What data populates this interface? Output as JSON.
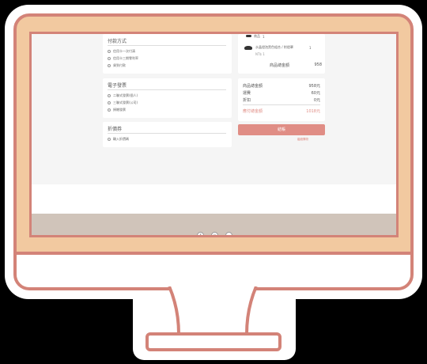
{
  "payment": {
    "title": "付款方式",
    "options": [
      "信用卡一次付清",
      "信用卡三期零利率",
      "貨到付款"
    ]
  },
  "invoice": {
    "title": "電子發票",
    "options": [
      "二聯式發票(個人)",
      "三聯式發票(公司)",
      "捐贈發票"
    ]
  },
  "notes": {
    "title": "折價券",
    "options": [
      "輸入折價碼"
    ]
  },
  "cart": {
    "items": [
      {
        "name": "商品",
        "qty": "1"
      },
      {
        "name": "水晶燈泡黑色組合 / 附燈罩",
        "qty": "1"
      }
    ],
    "subtotal_label": "商品總金額",
    "subtotal_value": "958"
  },
  "summary": {
    "rows": [
      {
        "label": "商品總金額",
        "value": "958元"
      },
      {
        "label": "運費",
        "value": "60元"
      },
      {
        "label": "折扣",
        "value": "0元"
      }
    ],
    "total_label": "應付總金額",
    "total_value": "1018元",
    "checkout_label": "結帳",
    "continue_label": "繼續購物"
  },
  "colors": {
    "bezel": "#f2c9a0",
    "frame": "#d38378",
    "accent": "#e08d85",
    "footer": "#d0c4ba"
  },
  "footer": {
    "icons": [
      "facebook-icon",
      "instagram-icon",
      "line-icon"
    ]
  }
}
